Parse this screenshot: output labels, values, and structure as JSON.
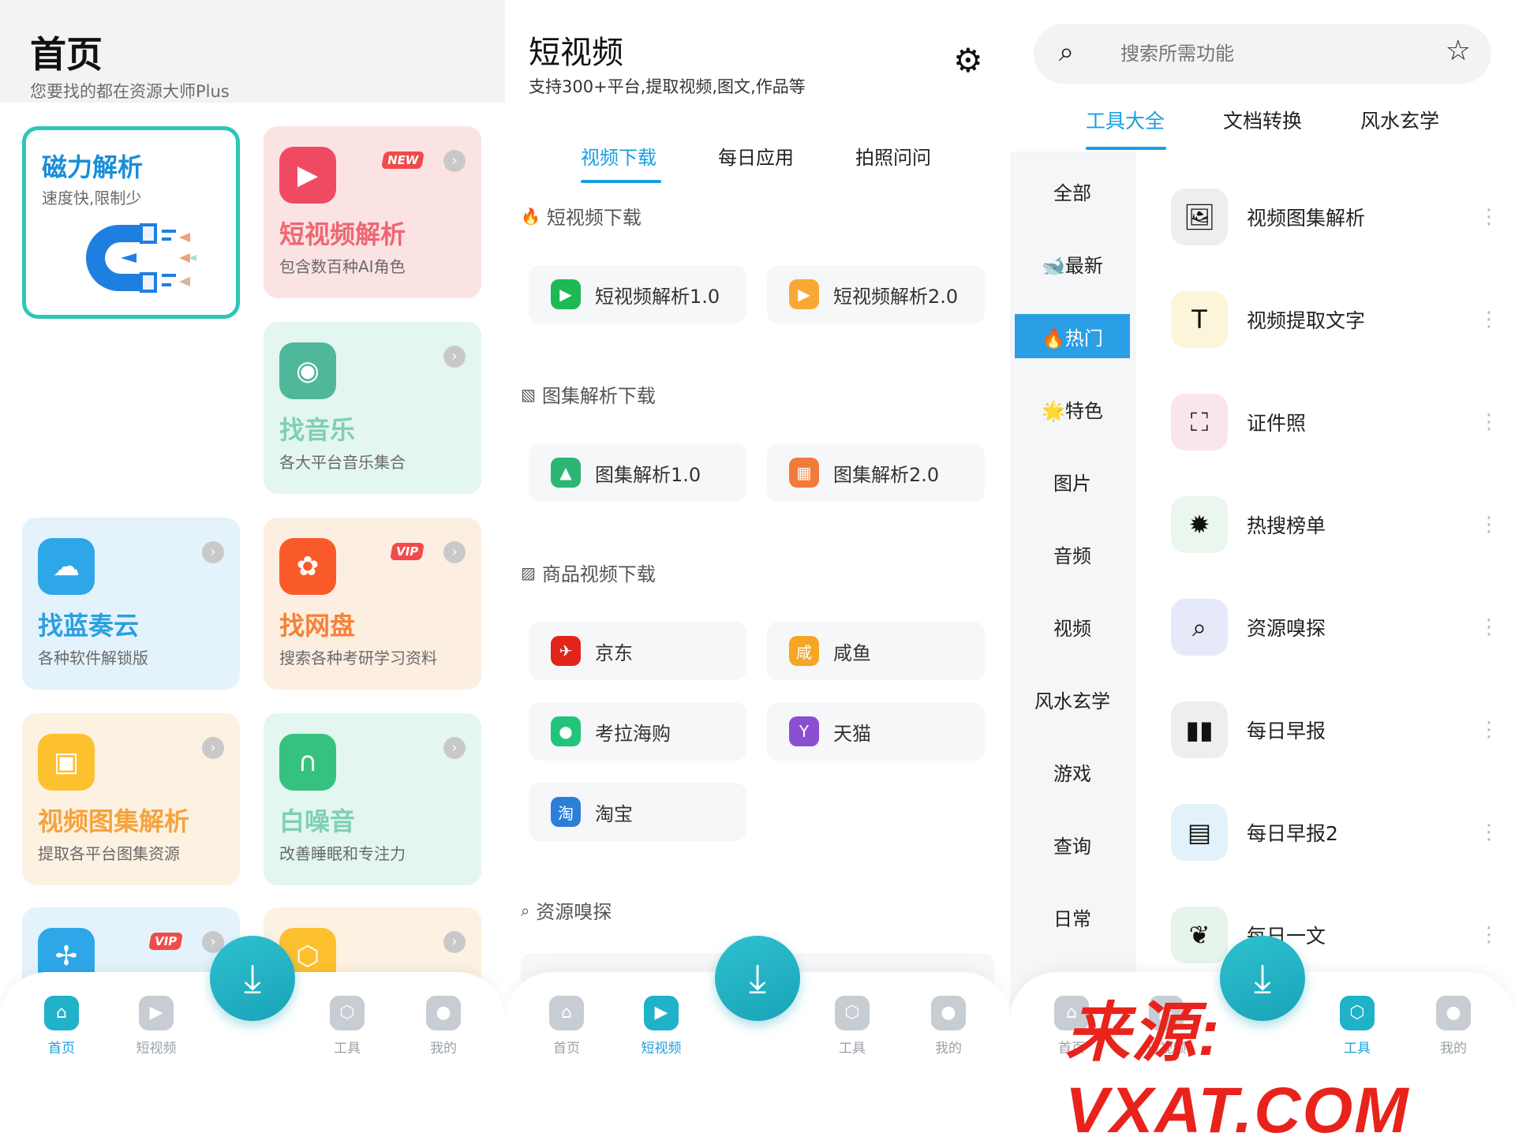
{
  "home": {
    "title": "首页",
    "subtitle": "您要找的都在资源大师Plus",
    "magnet_card": {
      "title": "磁力解析",
      "desc": "速度快,限制少"
    },
    "cards": [
      {
        "title": "短视频解析",
        "desc": "包含数百种AI角色",
        "tag": "NEW",
        "icon": "video-play-icon",
        "title_color": "#f06672",
        "bg": "#fbe3e4",
        "icon_bg": "#f04a63"
      },
      {
        "title": "找音乐",
        "desc": "各大平台音乐集合",
        "tag": "",
        "icon": "vinyl-record-icon",
        "title_color": "#7fcfb6",
        "bg": "#e3f6f0",
        "icon_bg": "#4fb89a"
      },
      {
        "title": "找蓝奏云",
        "desc": "各种软件解锁版",
        "tag": "",
        "icon": "cloud-search-icon",
        "title_color": "#2b9fe0",
        "bg": "#e4f3fb",
        "icon_bg": "#2ea7e8"
      },
      {
        "title": "找网盘",
        "desc": "搜索各种考研学习资料",
        "tag": "VIP",
        "icon": "cloud-drive-icon",
        "title_color": "#f58238",
        "bg": "#fdeee2",
        "icon_bg": "#fa5a2a"
      },
      {
        "title": "视频图集解析",
        "desc": "提取各平台图集资源",
        "tag": "",
        "icon": "image-gallery-icon",
        "title_color": "#f5a33c",
        "bg": "#fdf1e2",
        "icon_bg": "#fdc02f"
      },
      {
        "title": "白噪音",
        "desc": "改善睡眠和专注力",
        "tag": "",
        "icon": "headphones-icon",
        "title_color": "#7fcfb6",
        "bg": "#e3f6f0",
        "icon_bg": "#34c27e"
      }
    ],
    "partial_cards": [
      {
        "tag": "VIP",
        "icon": "pinwheel-icon"
      },
      {
        "tag": "",
        "icon": "cube-icon"
      }
    ]
  },
  "short_video": {
    "title": "短视频",
    "subtitle": "支持300+平台,提取视频,图文,作品等",
    "tabs": [
      "视频下载",
      "每日应用",
      "拍照问问"
    ],
    "active_tab": 0,
    "sections": [
      {
        "title": "短视频下载",
        "icon": "fire-icon",
        "items": [
          {
            "label": "短视频解析1.0",
            "icon": "play-icon",
            "color": "#1db954"
          },
          {
            "label": "短视频解析2.0",
            "icon": "tv-icon",
            "color": "#f8a935"
          }
        ]
      },
      {
        "title": "图集解析下载",
        "icon": "picture-icon",
        "items": [
          {
            "label": "图集解析1.0",
            "icon": "image-icon",
            "color": "#2bb673"
          },
          {
            "label": "图集解析2.0",
            "icon": "images-icon",
            "color": "#f27b3b"
          }
        ]
      },
      {
        "title": "商品视频下载",
        "icon": "shopping-bag-icon",
        "items": [
          {
            "label": "京东",
            "icon": "jd-dog-icon",
            "color": "#e1251b"
          },
          {
            "label": "咸鱼",
            "icon": "xianyu-icon",
            "color": "#f5a623"
          },
          {
            "label": "考拉海购",
            "icon": "koala-icon",
            "color": "#21c47b"
          },
          {
            "label": "天猫",
            "icon": "tmall-icon",
            "color": "#8a4fd1"
          },
          {
            "label": "淘宝",
            "icon": "taobao-icon",
            "color": "#2b7fd8"
          }
        ]
      },
      {
        "title": "资源嗅探",
        "icon": "search-icon",
        "items": []
      }
    ]
  },
  "tools": {
    "search_placeholder": "搜索所需功能",
    "tabs": [
      "工具大全",
      "文档转换",
      "风水玄学"
    ],
    "active_tab": 0,
    "categories": [
      "全部",
      "🐋最新",
      "🔥热门",
      "🌟特色",
      "图片",
      "音频",
      "视频",
      "风水玄学",
      "游戏",
      "查询",
      "日常"
    ],
    "active_category": 2,
    "items": [
      {
        "label": "视频图集解析",
        "icon": "photo-icon",
        "bg": "#eceef0",
        "glyph": "🖼"
      },
      {
        "label": "视频提取文字",
        "icon": "video-text-icon",
        "bg": "#fbf6da",
        "glyph": "T"
      },
      {
        "label": "证件照",
        "icon": "id-photo-icon",
        "bg": "#f8e6ec",
        "glyph": "⛶"
      },
      {
        "label": "热搜榜单",
        "icon": "sun-icon",
        "bg": "#eaf6ee",
        "glyph": "✹"
      },
      {
        "label": "资源嗅探",
        "icon": "magnifier-icon",
        "bg": "#e6eaf8",
        "glyph": "⌕"
      },
      {
        "label": "每日早报",
        "icon": "book-icon",
        "bg": "#eceef0",
        "glyph": "▮▮"
      },
      {
        "label": "每日早报2",
        "icon": "newspaper-icon",
        "bg": "#e3f1fb",
        "glyph": "▤"
      },
      {
        "label": "每日一文",
        "icon": "leaf-icon",
        "bg": "#e6f4ec",
        "glyph": "❦"
      }
    ]
  },
  "nav": {
    "items": [
      "首页",
      "短视频",
      "工具",
      "我的"
    ]
  },
  "watermark": "来源: VXAT.COM"
}
